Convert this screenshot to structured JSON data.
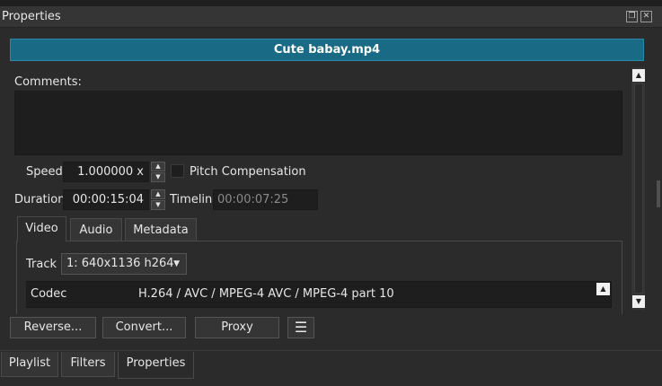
{
  "dock": {
    "title": "Properties",
    "float_icon": "float-icon",
    "close_icon": "close-icon"
  },
  "clip": {
    "filename": "Cute babay.mp4",
    "comments_label": "Comments:",
    "comments_value": ""
  },
  "speed": {
    "label": "Speed",
    "value": "1.000000 x",
    "pitch_label": "Pitch Compensation",
    "pitch_checked": false
  },
  "duration": {
    "label": "Duration",
    "value": "00:00:15:04",
    "timeline_label": "Timeline",
    "timeline_value": "00:00:07:25"
  },
  "tabs": [
    {
      "label": "Video",
      "active": true
    },
    {
      "label": "Audio",
      "active": false
    },
    {
      "label": "Metadata",
      "active": false
    }
  ],
  "video": {
    "track_label": "Track",
    "track_value": "1: 640x1136 h264",
    "rows": [
      {
        "key": "Codec",
        "value": "H.264 / AVC / MPEG-4 AVC / MPEG-4 part 10"
      }
    ]
  },
  "buttons": {
    "reverse": "Reverse...",
    "convert": "Convert...",
    "proxy": "Proxy",
    "menu": "☰"
  },
  "bottom_tabs": [
    {
      "label": "Playlist",
      "active": false
    },
    {
      "label": "Filters",
      "active": false
    },
    {
      "label": "Properties",
      "active": true
    }
  ],
  "colors": {
    "filename_bar": "#186a85",
    "background": "#2b2b2b"
  }
}
